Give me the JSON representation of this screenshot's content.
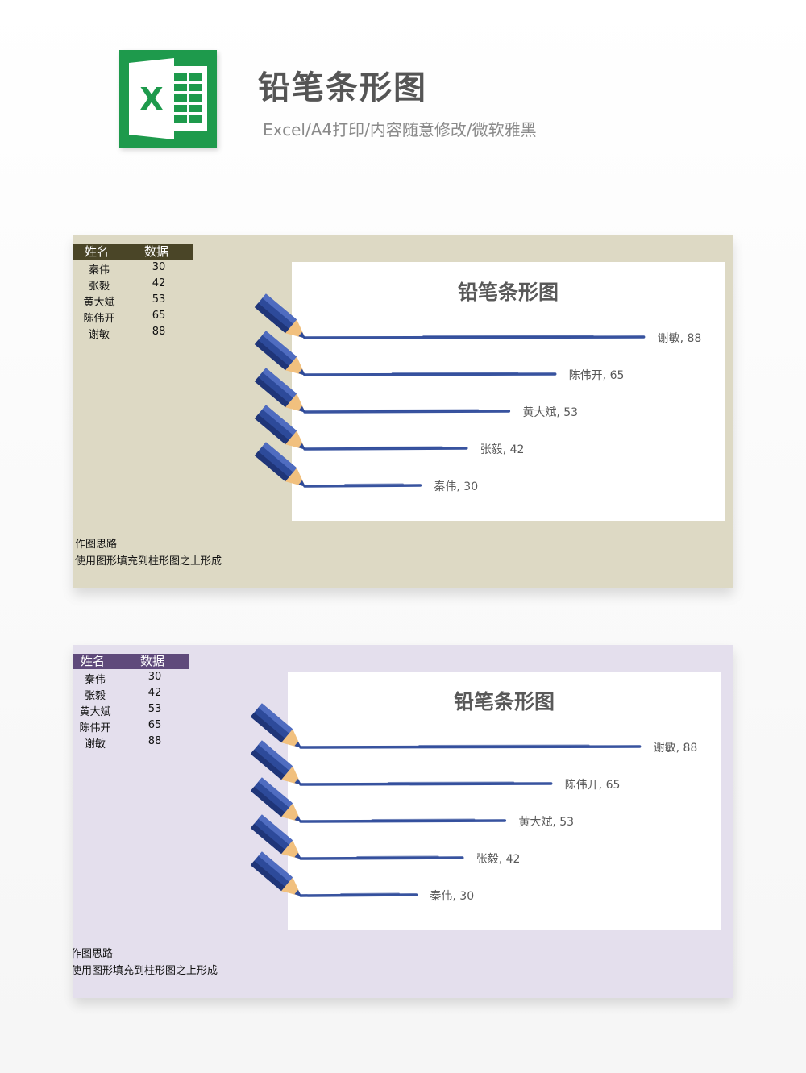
{
  "header": {
    "title": "铅笔条形图",
    "subtitle": "Excel/A4打印/内容随意修改/微软雅黑",
    "logo_letter": "X"
  },
  "panels": [
    {
      "table": {
        "headers": [
          "姓名",
          "数据"
        ],
        "rows": [
          [
            "秦伟",
            "30"
          ],
          [
            "张毅",
            "42"
          ],
          [
            "黄大斌",
            "53"
          ],
          [
            "陈伟开",
            "65"
          ],
          [
            "谢敏",
            "88"
          ]
        ]
      },
      "notes": [
        "作图思路",
        "使用图形填充到柱形图之上形成"
      ],
      "chart_title": "铅笔条形图"
    },
    {
      "table": {
        "headers": [
          "姓名",
          "数据"
        ],
        "rows": [
          [
            "秦伟",
            "30"
          ],
          [
            "张毅",
            "42"
          ],
          [
            "黄大斌",
            "53"
          ],
          [
            "陈伟开",
            "65"
          ],
          [
            "谢敏",
            "88"
          ]
        ]
      },
      "notes": [
        "作图思路",
        "使用图形填充到柱形图之上形成"
      ],
      "chart_title": "铅笔条形图"
    }
  ],
  "chart_data": {
    "type": "bar",
    "orientation": "horizontal",
    "title": "铅笔条形图",
    "categories": [
      "秦伟",
      "张毅",
      "黄大斌",
      "陈伟开",
      "谢敏"
    ],
    "values": [
      30,
      42,
      53,
      65,
      88
    ],
    "data_labels": [
      "秦伟, 30",
      "张毅, 42",
      "黄大斌, 53",
      "陈伟开, 65",
      "谢敏, 88"
    ],
    "bar_color": "#2d4a9a",
    "pencil_wood_color": "#f1c07e",
    "pencil_body_color": "#2d4a9a"
  }
}
